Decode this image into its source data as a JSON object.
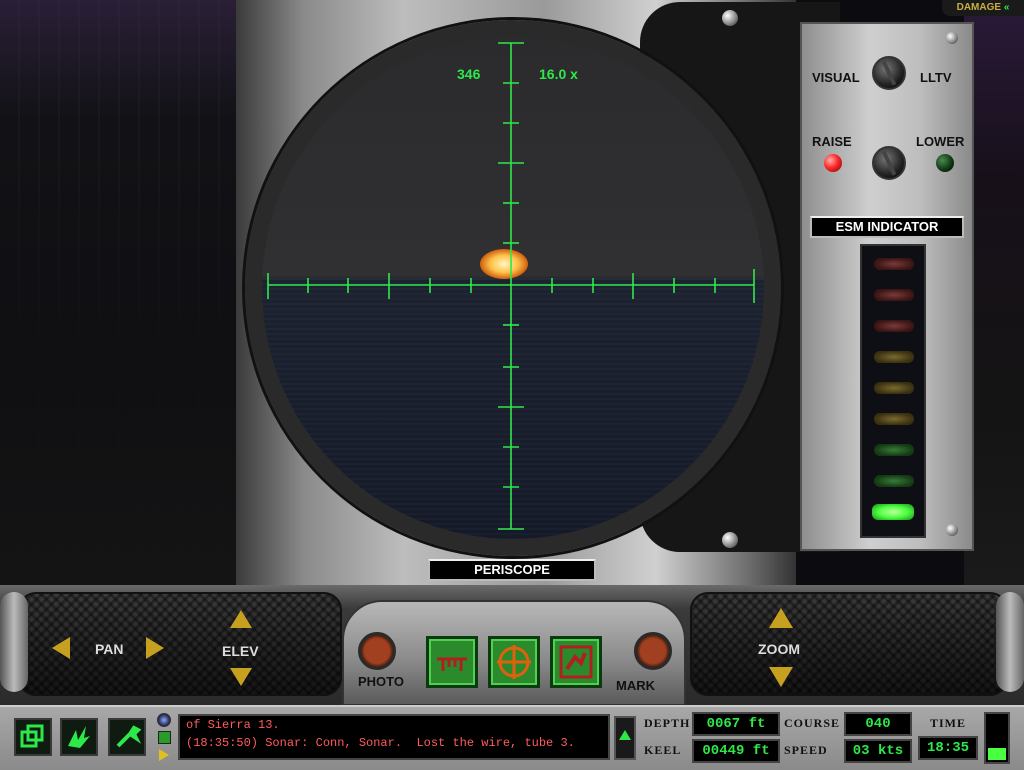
{
  "top_tab": {
    "label": "DAMAGE",
    "icon": "double-chevron-left-icon"
  },
  "periscope": {
    "bearing": "346",
    "magnification": "16.0 x",
    "title": "PERISCOPE"
  },
  "control_panel": {
    "visual_label": "VISUAL",
    "lltv_label": "LLTV",
    "raise_label": "RAISE",
    "lower_label": "LOWER",
    "esm_title": "ESM INDICATOR",
    "esm_lights": [
      "red",
      "red",
      "red",
      "amber",
      "amber",
      "amber",
      "green",
      "green",
      "bright-green"
    ],
    "colors": {
      "raise_led": "#ff2a2a",
      "lower_led": "#113a14"
    }
  },
  "controls": {
    "pan_label": "PAN",
    "elev_label": "ELEV",
    "zoom_label": "ZOOM",
    "photo_label": "PHOTO",
    "mark_label": "MARK",
    "buttons": [
      "periscope-mode-icon",
      "crosshair-icon",
      "map-icon"
    ]
  },
  "status": {
    "toolbar_icons": [
      "windows-icon",
      "sonar-burst-icon",
      "wrench-icon"
    ],
    "messages": [
      "of Sierra 13.",
      "(18:35:50) Sonar: Conn, Sonar.  Lost the wire, tube 3."
    ],
    "depth_label": "DEPTH",
    "depth_value": "0067 ft",
    "keel_label": "KEEL",
    "keel_value": "00449 ft",
    "course_label": "COURSE",
    "course_value": "040",
    "speed_label": "SPEED",
    "speed_value": "03 kts",
    "time_label": "TIME",
    "time_value": "18:35"
  }
}
